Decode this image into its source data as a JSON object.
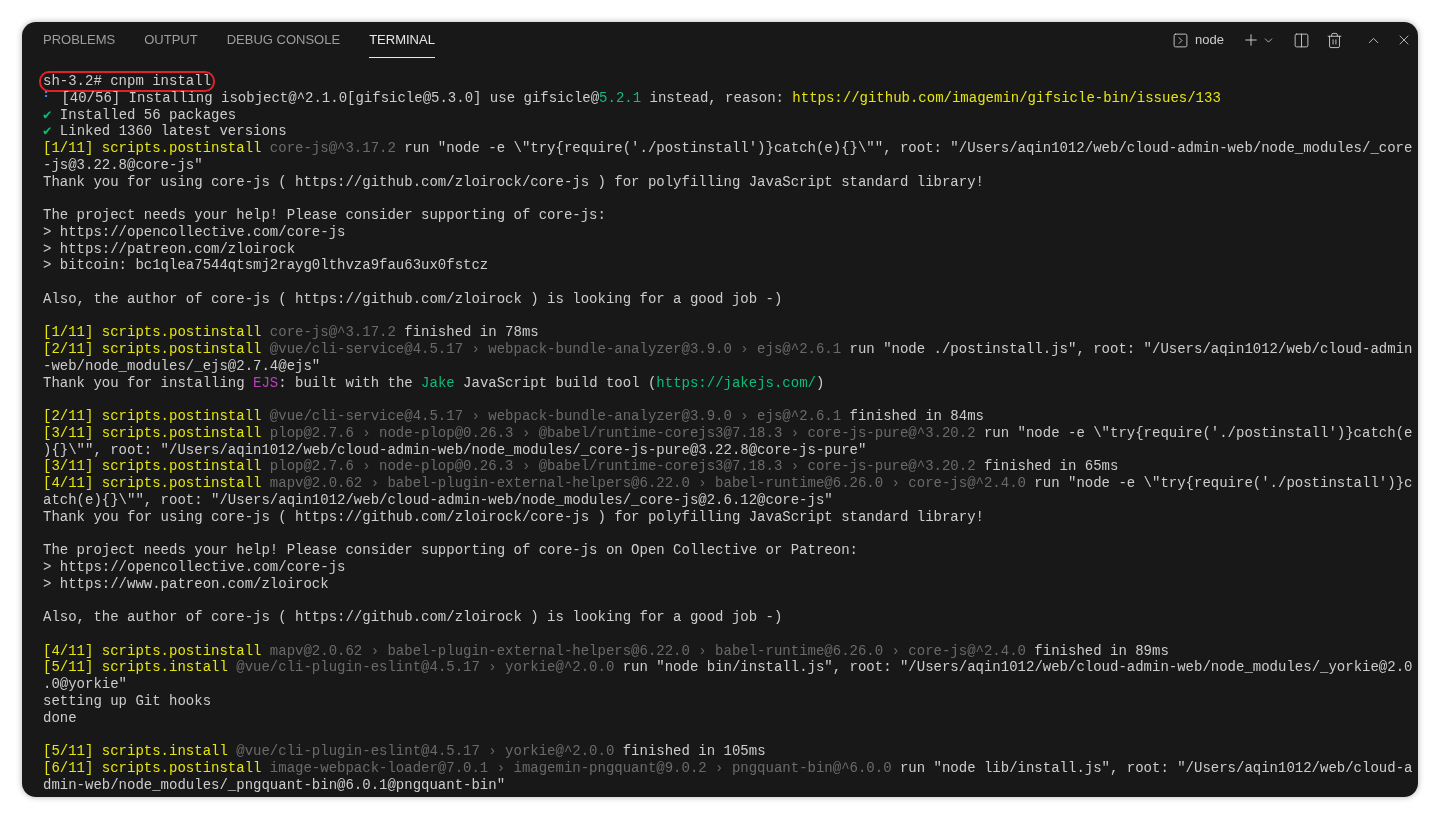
{
  "tabs": [
    {
      "label": "PROBLEMS",
      "selected": false
    },
    {
      "label": "OUTPUT",
      "selected": false
    },
    {
      "label": "DEBUG CONSOLE",
      "selected": false
    },
    {
      "label": "TERMINAL",
      "selected": true
    }
  ],
  "toolbar": {
    "profile": "node"
  },
  "terminal": {
    "lines": [
      {
        "kind": "text",
        "highlighted": true,
        "segments": [
          {
            "kind": "plain",
            "text": "sh-3.2# cnpm install"
          }
        ]
      },
      {
        "kind": "text",
        "segments": [
          {
            "kind": "spinner",
            "text": "⠃"
          },
          {
            "kind": "plain",
            "text": " [40/56] Installing isobject@^2.1.0[gifsicle@5.3.0] use gifsicle@"
          },
          {
            "kind": "green",
            "text": "5.2.1"
          },
          {
            "kind": "plain",
            "text": " instead, reason: "
          },
          {
            "kind": "yellow",
            "text": "https://github.com/imagemin/gifsicle-bin/issues/133"
          }
        ]
      },
      {
        "kind": "text",
        "segments": [
          {
            "kind": "green",
            "text": "✔"
          },
          {
            "kind": "plain",
            "text": " Installed 56 packages"
          }
        ]
      },
      {
        "kind": "text",
        "segments": [
          {
            "kind": "green",
            "text": "✔"
          },
          {
            "kind": "plain",
            "text": " Linked 1360 latest versions"
          }
        ]
      },
      {
        "kind": "text",
        "segments": [
          {
            "kind": "yellow",
            "text": "[1/11] scripts.postinstall"
          },
          {
            "kind": "dim",
            "text": " core-js@^3.17.2"
          },
          {
            "kind": "plain",
            "text": " run \"node -e \\\"try{require('./postinstall')}catch(e){}\\\"\", root: \"/Users/aqin1012/web/cloud-admin-web/node_modules/_core"
          }
        ]
      },
      {
        "kind": "text",
        "segments": [
          {
            "kind": "plain",
            "text": "-js@3.22.8@core-js\""
          }
        ]
      },
      {
        "kind": "text",
        "segments": [
          {
            "kind": "plain",
            "text": "Thank you for using core-js ( https://github.com/zloirock/core-js ) for polyfilling JavaScript standard library!"
          }
        ]
      },
      {
        "kind": "blank"
      },
      {
        "kind": "text",
        "segments": [
          {
            "kind": "plain",
            "text": "The project needs your help! Please consider supporting of core-js:"
          }
        ]
      },
      {
        "kind": "text",
        "segments": [
          {
            "kind": "plain",
            "text": "> https://opencollective.com/core-js"
          }
        ]
      },
      {
        "kind": "text",
        "segments": [
          {
            "kind": "plain",
            "text": "> https://patreon.com/zloirock"
          }
        ]
      },
      {
        "kind": "text",
        "segments": [
          {
            "kind": "plain",
            "text": "> bitcoin: bc1qlea7544qtsmj2rayg0lthvza9fau63ux0fstcz"
          }
        ]
      },
      {
        "kind": "blank"
      },
      {
        "kind": "text",
        "segments": [
          {
            "kind": "plain",
            "text": "Also, the author of core-js ( https://github.com/zloirock ) is looking for a good job -)"
          }
        ]
      },
      {
        "kind": "blank"
      },
      {
        "kind": "text",
        "segments": [
          {
            "kind": "yellow",
            "text": "[1/11] scripts.postinstall"
          },
          {
            "kind": "dim",
            "text": " core-js@^3.17.2"
          },
          {
            "kind": "plain",
            "text": " finished in 78ms"
          }
        ]
      },
      {
        "kind": "text",
        "segments": [
          {
            "kind": "yellow",
            "text": "[2/11] scripts.postinstall"
          },
          {
            "kind": "dim",
            "text": " @vue/cli-service@4.5.17 › webpack-bundle-analyzer@3.9.0 › ejs@^2.6.1"
          },
          {
            "kind": "plain",
            "text": " run \"node ./postinstall.js\", root: \"/Users/aqin1012/web/cloud-admin"
          }
        ]
      },
      {
        "kind": "text",
        "segments": [
          {
            "kind": "plain",
            "text": "-web/node_modules/_ejs@2.7.4@ejs\""
          }
        ]
      },
      {
        "kind": "text",
        "segments": [
          {
            "kind": "plain",
            "text": "Thank you for installing "
          },
          {
            "kind": "magenta",
            "text": "EJS"
          },
          {
            "kind": "plain",
            "text": ": built with the "
          },
          {
            "kind": "green",
            "text": "Jake"
          },
          {
            "kind": "plain",
            "text": " JavaScript build tool ("
          },
          {
            "kind": "green",
            "text": "https://jakejs.com/"
          },
          {
            "kind": "plain",
            "text": ")"
          }
        ]
      },
      {
        "kind": "blank"
      },
      {
        "kind": "text",
        "segments": [
          {
            "kind": "yellow",
            "text": "[2/11] scripts.postinstall"
          },
          {
            "kind": "dim",
            "text": " @vue/cli-service@4.5.17 › webpack-bundle-analyzer@3.9.0 › ejs@^2.6.1"
          },
          {
            "kind": "plain",
            "text": " finished in 84ms"
          }
        ]
      },
      {
        "kind": "text",
        "segments": [
          {
            "kind": "yellow",
            "text": "[3/11] scripts.postinstall"
          },
          {
            "kind": "dim",
            "text": " plop@2.7.6 › node-plop@0.26.3 › @babel/runtime-corejs3@7.18.3 › core-js-pure@^3.20.2"
          },
          {
            "kind": "plain",
            "text": " run \"node -e \\\"try{require('./postinstall')}catch(e"
          }
        ]
      },
      {
        "kind": "text",
        "segments": [
          {
            "kind": "plain",
            "text": "){}\\\"\", root: \"/Users/aqin1012/web/cloud-admin-web/node_modules/_core-js-pure@3.22.8@core-js-pure\""
          }
        ]
      },
      {
        "kind": "text",
        "segments": [
          {
            "kind": "yellow",
            "text": "[3/11] scripts.postinstall"
          },
          {
            "kind": "dim",
            "text": " plop@2.7.6 › node-plop@0.26.3 › @babel/runtime-corejs3@7.18.3 › core-js-pure@^3.20.2"
          },
          {
            "kind": "plain",
            "text": " finished in 65ms"
          }
        ]
      },
      {
        "kind": "text",
        "segments": [
          {
            "kind": "yellow",
            "text": "[4/11] scripts.postinstall"
          },
          {
            "kind": "dim",
            "text": " mapv@2.0.62 › babel-plugin-external-helpers@6.22.0 › babel-runtime@6.26.0 › core-js@^2.4.0"
          },
          {
            "kind": "plain",
            "text": " run \"node -e \\\"try{require('./postinstall')}c"
          }
        ]
      },
      {
        "kind": "text",
        "segments": [
          {
            "kind": "plain",
            "text": "atch(e){}\\\"\", root: \"/Users/aqin1012/web/cloud-admin-web/node_modules/_core-js@2.6.12@core-js\""
          }
        ]
      },
      {
        "kind": "text",
        "segments": [
          {
            "kind": "plain",
            "text": "Thank you for using core-js ( https://github.com/zloirock/core-js ) for polyfilling JavaScript standard library!"
          }
        ]
      },
      {
        "kind": "blank"
      },
      {
        "kind": "text",
        "segments": [
          {
            "kind": "plain",
            "text": "The project needs your help! Please consider supporting of core-js on Open Collective or Patreon:"
          }
        ]
      },
      {
        "kind": "text",
        "segments": [
          {
            "kind": "plain",
            "text": "> https://opencollective.com/core-js"
          }
        ]
      },
      {
        "kind": "text",
        "segments": [
          {
            "kind": "plain",
            "text": "> https://www.patreon.com/zloirock"
          }
        ]
      },
      {
        "kind": "blank"
      },
      {
        "kind": "text",
        "segments": [
          {
            "kind": "plain",
            "text": "Also, the author of core-js ( https://github.com/zloirock ) is looking for a good job -)"
          }
        ]
      },
      {
        "kind": "blank"
      },
      {
        "kind": "text",
        "segments": [
          {
            "kind": "yellow",
            "text": "[4/11] scripts.postinstall"
          },
          {
            "kind": "dim",
            "text": " mapv@2.0.62 › babel-plugin-external-helpers@6.22.0 › babel-runtime@6.26.0 › core-js@^2.4.0"
          },
          {
            "kind": "plain",
            "text": " finished in 89ms"
          }
        ]
      },
      {
        "kind": "text",
        "segments": [
          {
            "kind": "yellow",
            "text": "[5/11] scripts.install"
          },
          {
            "kind": "dim",
            "text": " @vue/cli-plugin-eslint@4.5.17 › yorkie@^2.0.0"
          },
          {
            "kind": "plain",
            "text": " run \"node bin/install.js\", root: \"/Users/aqin1012/web/cloud-admin-web/node_modules/_yorkie@2.0"
          }
        ]
      },
      {
        "kind": "text",
        "segments": [
          {
            "kind": "plain",
            "text": ".0@yorkie\""
          }
        ]
      },
      {
        "kind": "text",
        "segments": [
          {
            "kind": "plain",
            "text": "setting up Git hooks"
          }
        ]
      },
      {
        "kind": "text",
        "segments": [
          {
            "kind": "plain",
            "text": "done"
          }
        ]
      },
      {
        "kind": "blank"
      },
      {
        "kind": "text",
        "segments": [
          {
            "kind": "yellow",
            "text": "[5/11] scripts.install"
          },
          {
            "kind": "dim",
            "text": " @vue/cli-plugin-eslint@4.5.17 › yorkie@^2.0.0"
          },
          {
            "kind": "plain",
            "text": " finished in 105ms"
          }
        ]
      },
      {
        "kind": "text",
        "segments": [
          {
            "kind": "yellow",
            "text": "[6/11] scripts.postinstall"
          },
          {
            "kind": "dim",
            "text": " image-webpack-loader@7.0.1 › imagemin-pngquant@9.0.2 › pngquant-bin@^6.0.0"
          },
          {
            "kind": "plain",
            "text": " run \"node lib/install.js\", root: \"/Users/aqin1012/web/cloud-a"
          }
        ]
      },
      {
        "kind": "text",
        "segments": [
          {
            "kind": "plain",
            "text": "dmin-web/node_modules/_pngquant-bin@6.0.1@pngquant-bin\""
          }
        ]
      }
    ]
  }
}
